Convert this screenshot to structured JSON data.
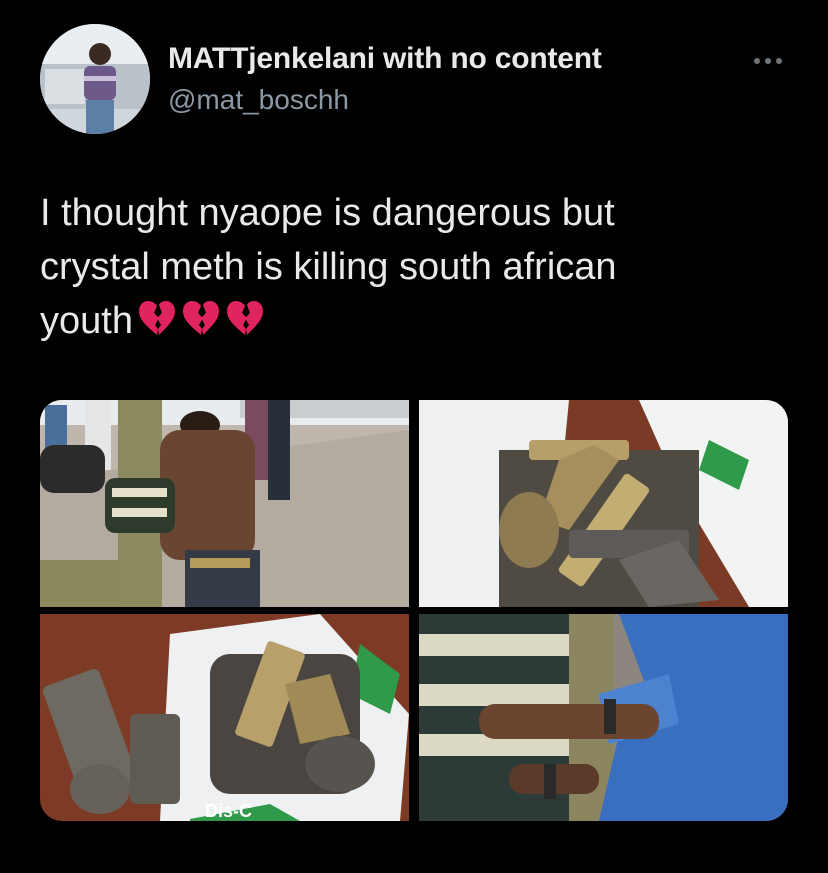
{
  "tweet": {
    "author_name": "MATTjenkelani with no content",
    "author_handle": "@mat_boschh",
    "text_lines": [
      "I thought nyaope is dangerous but",
      "crystal meth is killing south african",
      "youth"
    ],
    "emojis": [
      "broken-heart-icon",
      "broken-heart-icon",
      "broken-heart-icon"
    ]
  },
  "media": {
    "count": 4,
    "bag_print_text": "Dis-C"
  },
  "colors": {
    "background": "#000000",
    "primary_text": "#e7e9ea",
    "secondary_text": "#8b98a5",
    "broken_heart": "#e0245e"
  }
}
